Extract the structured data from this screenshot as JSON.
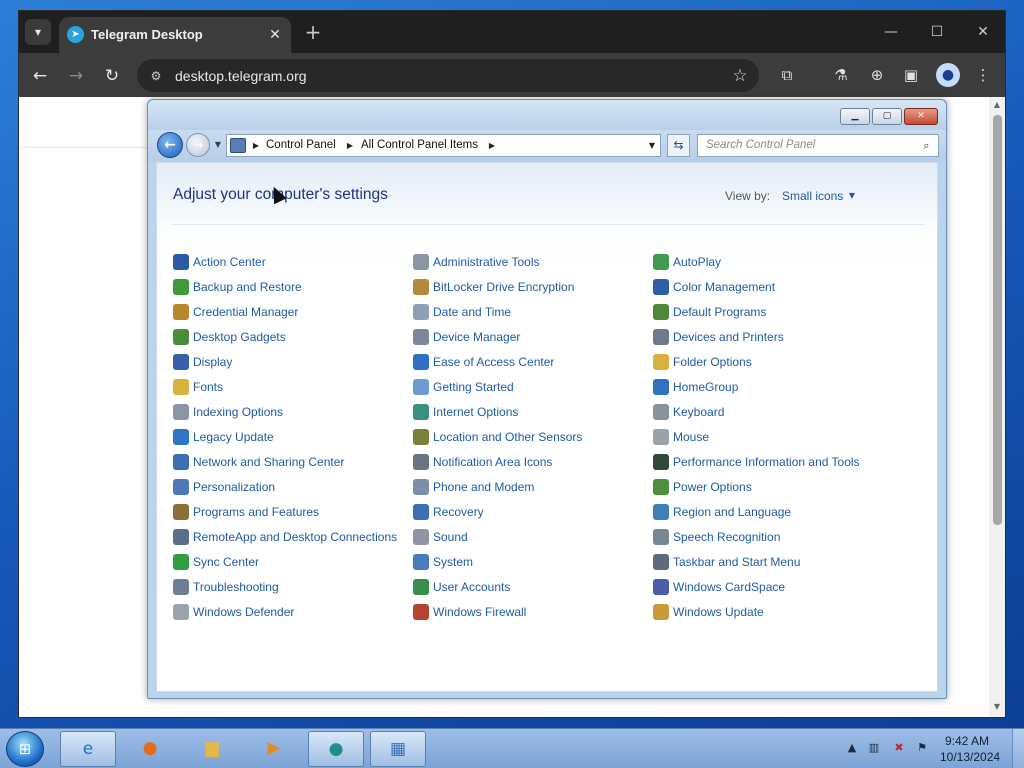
{
  "browser": {
    "tab_title": "Telegram Desktop",
    "url": "desktop.telegram.org"
  },
  "control_panel": {
    "breadcrumbs": [
      "Control Panel",
      "All Control Panel Items"
    ],
    "search_placeholder": "Search Control Panel",
    "heading": "Adjust your computer's settings",
    "view_by_label": "View by:",
    "view_by_value": "Small icons",
    "columns": [
      [
        {
          "label": "Action Center",
          "icon": "flag-icon",
          "color": "#2b5aa8"
        },
        {
          "label": "Backup and Restore",
          "icon": "backup-icon",
          "color": "#3d9b3d"
        },
        {
          "label": "Credential Manager",
          "icon": "vault-icon",
          "color": "#b68a2c"
        },
        {
          "label": "Desktop Gadgets",
          "icon": "gadgets-icon",
          "color": "#4a8c3a"
        },
        {
          "label": "Display",
          "icon": "monitor-icon",
          "color": "#3561a8"
        },
        {
          "label": "Fonts",
          "icon": "fonts-folder-icon",
          "color": "#d9b23c"
        },
        {
          "label": "Indexing Options",
          "icon": "indexing-icon",
          "color": "#8a95a6"
        },
        {
          "label": "Legacy Update",
          "icon": "globe-icon",
          "color": "#2f75c9"
        },
        {
          "label": "Network and Sharing Center",
          "icon": "network-icon",
          "color": "#3f6db3"
        },
        {
          "label": "Personalization",
          "icon": "personalization-icon",
          "color": "#4f78b8"
        },
        {
          "label": "Programs and Features",
          "icon": "programs-icon",
          "color": "#8a6f3a"
        },
        {
          "label": "RemoteApp and Desktop Connections",
          "icon": "remoteapp-icon",
          "color": "#5a6f8c"
        },
        {
          "label": "Sync Center",
          "icon": "sync-icon",
          "color": "#2ea043"
        },
        {
          "label": "Troubleshooting",
          "icon": "troubleshoot-icon",
          "color": "#6e7f96"
        },
        {
          "label": "Windows Defender",
          "icon": "defender-icon",
          "color": "#9aa3ad"
        }
      ],
      [
        {
          "label": "Administrative Tools",
          "icon": "admin-tools-icon",
          "color": "#8b96a4"
        },
        {
          "label": "BitLocker Drive Encryption",
          "icon": "bitlocker-icon",
          "color": "#b38a3b"
        },
        {
          "label": "Date and Time",
          "icon": "clock-icon",
          "color": "#8fa0b6"
        },
        {
          "label": "Device Manager",
          "icon": "device-manager-icon",
          "color": "#7b8899"
        },
        {
          "label": "Ease of Access Center",
          "icon": "ease-of-access-icon",
          "color": "#2f6fc4"
        },
        {
          "label": "Getting Started",
          "icon": "getting-started-icon",
          "color": "#6b9bd0"
        },
        {
          "label": "Internet Options",
          "icon": "internet-options-icon",
          "color": "#3d8f7d"
        },
        {
          "label": "Location and Other Sensors",
          "icon": "sensors-icon",
          "color": "#7b7f3a"
        },
        {
          "label": "Notification Area Icons",
          "icon": "notification-icon",
          "color": "#6a7584"
        },
        {
          "label": "Phone and Modem",
          "icon": "phone-icon",
          "color": "#7b8fa8"
        },
        {
          "label": "Recovery",
          "icon": "recovery-icon",
          "color": "#3e6fb3"
        },
        {
          "label": "Sound",
          "icon": "speaker-icon",
          "color": "#8d96a2"
        },
        {
          "label": "System",
          "icon": "system-icon",
          "color": "#4a7bbf"
        },
        {
          "label": "User Accounts",
          "icon": "users-icon",
          "color": "#3a8d4a"
        },
        {
          "label": "Windows Firewall",
          "icon": "firewall-icon",
          "color": "#b5452e"
        }
      ],
      [
        {
          "label": "AutoPlay",
          "icon": "autoplay-icon",
          "color": "#3f9a4b"
        },
        {
          "label": "Color Management",
          "icon": "color-management-icon",
          "color": "#2f5fa8"
        },
        {
          "label": "Default Programs",
          "icon": "default-programs-icon",
          "color": "#4f8a3c"
        },
        {
          "label": "Devices and Printers",
          "icon": "printer-icon",
          "color": "#6b7a8c"
        },
        {
          "label": "Folder Options",
          "icon": "folder-icon",
          "color": "#d8b13e"
        },
        {
          "label": "HomeGroup",
          "icon": "homegroup-icon",
          "color": "#3271c2"
        },
        {
          "label": "Keyboard",
          "icon": "keyboard-icon",
          "color": "#8a929c"
        },
        {
          "label": "Mouse",
          "icon": "mouse-icon",
          "color": "#9aa1aa"
        },
        {
          "label": "Performance Information and Tools",
          "icon": "performance-icon",
          "color": "#2e4a3a"
        },
        {
          "label": "Power Options",
          "icon": "power-icon",
          "color": "#4d8f3c"
        },
        {
          "label": "Region and Language",
          "icon": "region-icon",
          "color": "#3f7fb3"
        },
        {
          "label": "Speech Recognition",
          "icon": "microphone-icon",
          "color": "#7a8593"
        },
        {
          "label": "Taskbar and Start Menu",
          "icon": "taskbar-icon",
          "color": "#5d6a7a"
        },
        {
          "label": "Windows CardSpace",
          "icon": "cardspace-icon",
          "color": "#4a5fa8"
        },
        {
          "label": "Windows Update",
          "icon": "windows-update-icon",
          "color": "#c99a3a"
        }
      ]
    ]
  },
  "taskbar": {
    "clock_time": "9:42 AM",
    "clock_date": "10/13/2024"
  }
}
